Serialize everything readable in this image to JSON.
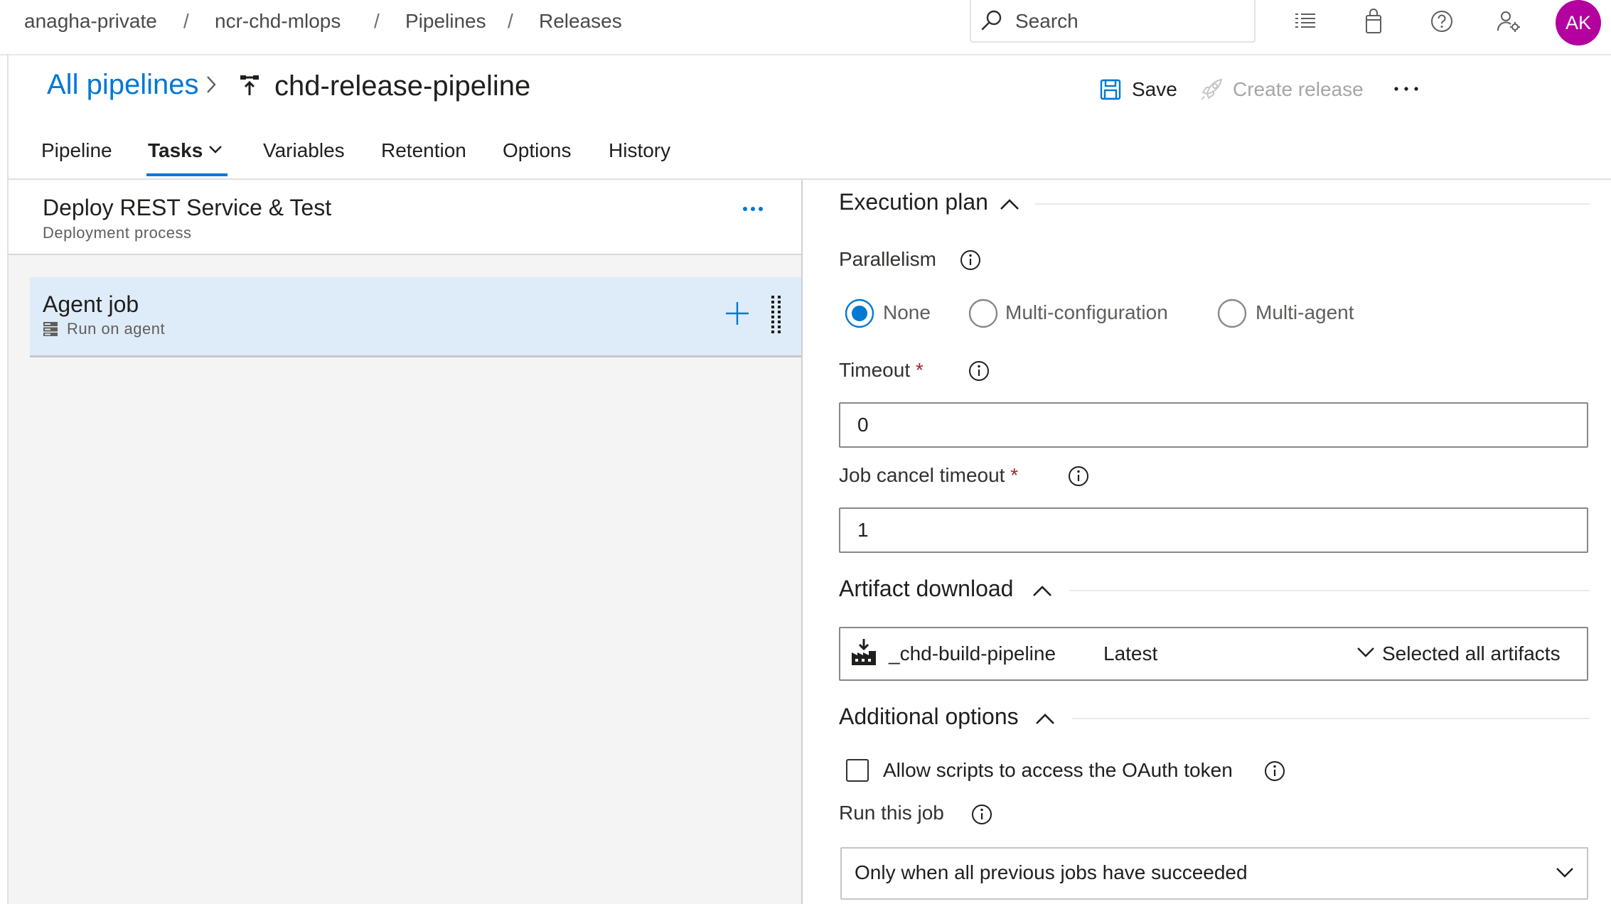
{
  "breadcrumb": {
    "items": [
      "anagha-private",
      "ncr-chd-mlops",
      "Pipelines",
      "Releases"
    ],
    "separator": "/"
  },
  "search": {
    "placeholder": "Search"
  },
  "user": {
    "initials": "AK",
    "avatar_color": "#b4009e"
  },
  "header": {
    "all_pipelines": "All pipelines",
    "pipeline_name": "chd-release-pipeline",
    "save_label": "Save",
    "create_release_label": "Create release"
  },
  "tabs": [
    {
      "label": "Pipeline",
      "active": false
    },
    {
      "label": "Tasks",
      "active": true
    },
    {
      "label": "Variables",
      "active": false
    },
    {
      "label": "Retention",
      "active": false
    },
    {
      "label": "Options",
      "active": false
    },
    {
      "label": "History",
      "active": false
    }
  ],
  "stage": {
    "title": "Deploy REST Service & Test",
    "subtitle": "Deployment process"
  },
  "job": {
    "title": "Agent job",
    "subtitle": "Run on agent"
  },
  "execution_plan": {
    "title": "Execution plan",
    "parallelism_label": "Parallelism",
    "options": [
      "None",
      "Multi-configuration",
      "Multi-agent"
    ],
    "selected": "None",
    "timeout_label": "Timeout",
    "timeout_value": "0",
    "cancel_timeout_label": "Job cancel timeout",
    "cancel_timeout_value": "1",
    "required_marker": "*"
  },
  "artifact_download": {
    "title": "Artifact download",
    "artifact_name": "_chd-build-pipeline",
    "version": "Latest",
    "selection": "Selected all artifacts"
  },
  "additional_options": {
    "title": "Additional options",
    "oauth_label": "Allow scripts to access the OAuth token",
    "oauth_checked": false,
    "run_job_label": "Run this job",
    "run_job_value": "Only when all previous jobs have succeeded"
  },
  "colors": {
    "accent": "#0078d4",
    "selected_card": "#deecf9",
    "required": "#a4262c"
  }
}
